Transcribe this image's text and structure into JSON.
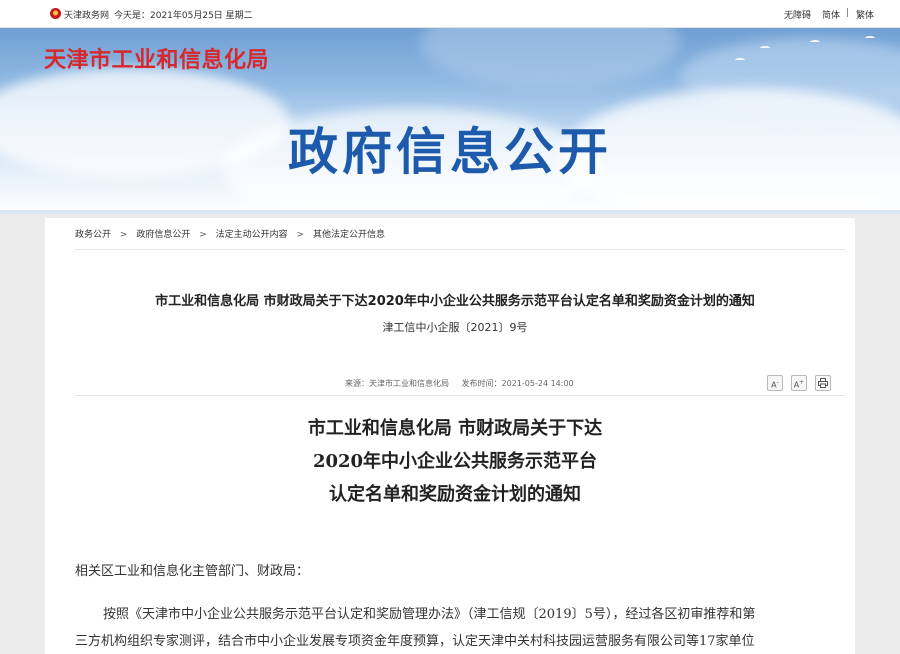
{
  "topbar": {
    "site_name": "天津政务网",
    "today": "今天是：2021年05月25日 星期二",
    "accessibility": "无障碍",
    "simplified": "简体",
    "separator": "|",
    "traditional": "繁体"
  },
  "banner": {
    "org_name": "天津市工业和信息化局",
    "section_title": "政府信息公开"
  },
  "breadcrumb": {
    "items": [
      "政务公开",
      "政府信息公开",
      "法定主动公开内容",
      "其他法定公开信息"
    ],
    "separator": ">"
  },
  "document": {
    "title": "市工业和信息化局 市财政局关于下达2020年中小企业公共服务示范平台认定名单和奖励资金计划的通知",
    "number": "津工信中小企服〔2021〕9号",
    "source": "来源：天津市工业和信息化局",
    "published": "发布时间：2021-05-24 14:00",
    "tools": {
      "font_larger": "A",
      "font_smaller": "A",
      "print_icon": "print-icon"
    },
    "content_title": [
      "市工业和信息化局 市财政局关于下达",
      "2020年中小企业公共服务示范平台",
      "认定名单和奖励资金计划的通知"
    ],
    "paragraphs": [
      "相关区工业和信息化主管部门、财政局：",
      "按照《天津市中小企业公共服务示范平台认定和奖励管理办法》（津工信规〔2019〕5号），经过各区初审推荐和第",
      "三方机构组织专家测评，结合市中小企业发展专项资金年度预算，认定天津中关村科技园运营服务有限公司等17家单位"
    ]
  },
  "colors": {
    "org_red": "#d7282d",
    "title_blue": "#1d5aab",
    "page_gray": "#ebebeb"
  }
}
